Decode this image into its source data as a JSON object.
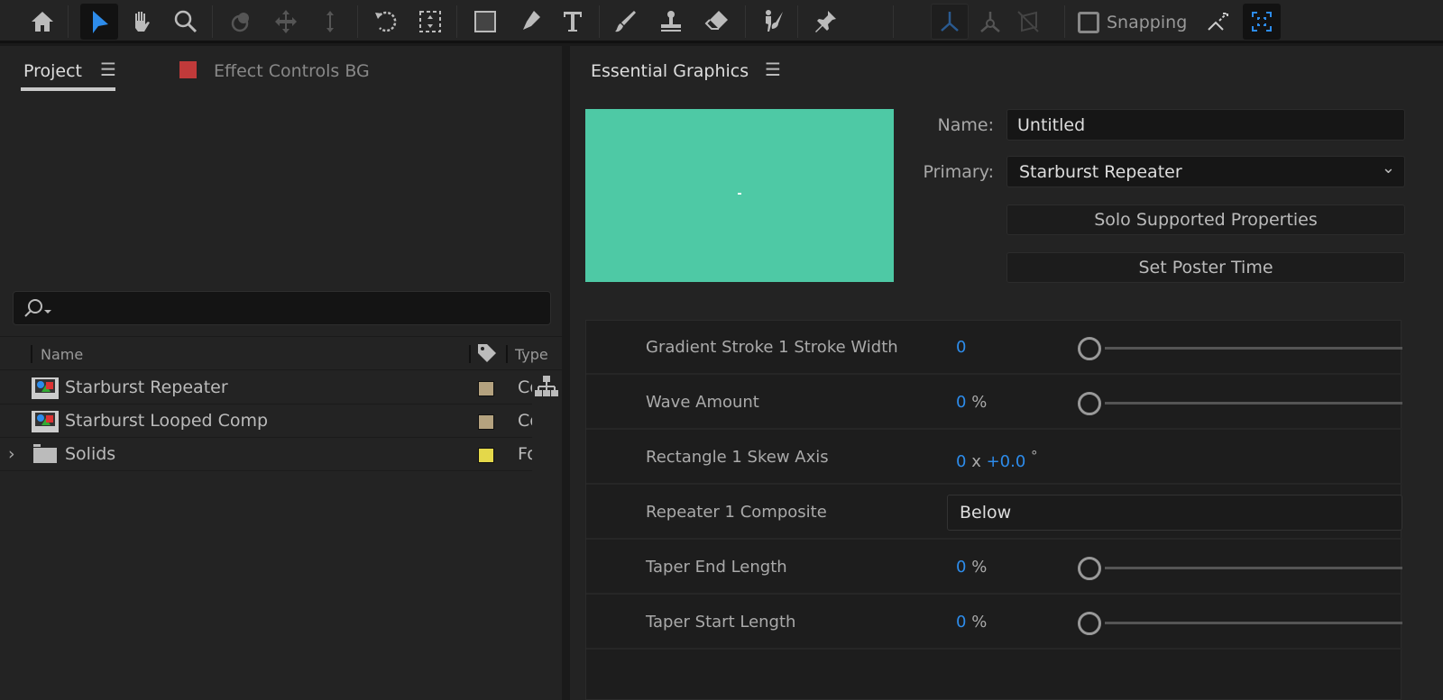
{
  "toolbar": {
    "tools": [
      "home-icon",
      "selection-icon",
      "hand-icon",
      "zoom-icon",
      "orbit-icon",
      "pan-icon",
      "dolly-icon",
      "rotate-icon",
      "anchor-icon",
      "rectangle-icon",
      "pen-icon",
      "type-icon",
      "brush-icon",
      "stamp-icon",
      "eraser-icon",
      "puppet-icon",
      "pin-icon"
    ],
    "selected_tool": "selection-icon",
    "snapping_label": "Snapping",
    "accent": "#2d8ceb"
  },
  "left_panel": {
    "tab_project": "Project",
    "tab_effect_controls": "Effect Controls BG",
    "effect_controls_color": "#c03a3a",
    "columns": {
      "name": "Name",
      "type": "Type"
    },
    "items": [
      {
        "name": "Starburst Repeater",
        "type": "Co",
        "label_color": "#b4a27f",
        "icon": "composition-icon"
      },
      {
        "name": "Starburst Looped Comp",
        "type": "Co",
        "label_color": "#b4a27f",
        "icon": "composition-icon"
      },
      {
        "name": "Solids",
        "type": "Fo",
        "label_color": "#e4d84a",
        "icon": "folder-icon"
      }
    ]
  },
  "right_panel": {
    "title": "Essential Graphics",
    "preview_color": "#4ec9a5",
    "name_label": "Name:",
    "name_value": "Untitled",
    "primary_label": "Primary:",
    "primary_value": "Starburst Repeater",
    "solo_button": "Solo Supported Properties",
    "poster_button": "Set Poster Time",
    "properties": [
      {
        "name": "Gradient Stroke 1 Stroke Width",
        "value": "0",
        "unit": "",
        "slider": 0
      },
      {
        "name": "Wave Amount",
        "value": "0",
        "unit": "%",
        "slider": 0
      },
      {
        "name": "Rectangle 1 Skew Axis",
        "value": "0",
        "sep": "x",
        "value2": "+0.0",
        "unit": "°"
      },
      {
        "name": "Repeater 1 Composite",
        "dropdown": "Below"
      },
      {
        "name": "Taper End Length",
        "value": "0",
        "unit": "%",
        "slider": 0
      },
      {
        "name": "Taper Start Length",
        "value": "0",
        "unit": "%",
        "slider": 0
      }
    ]
  }
}
